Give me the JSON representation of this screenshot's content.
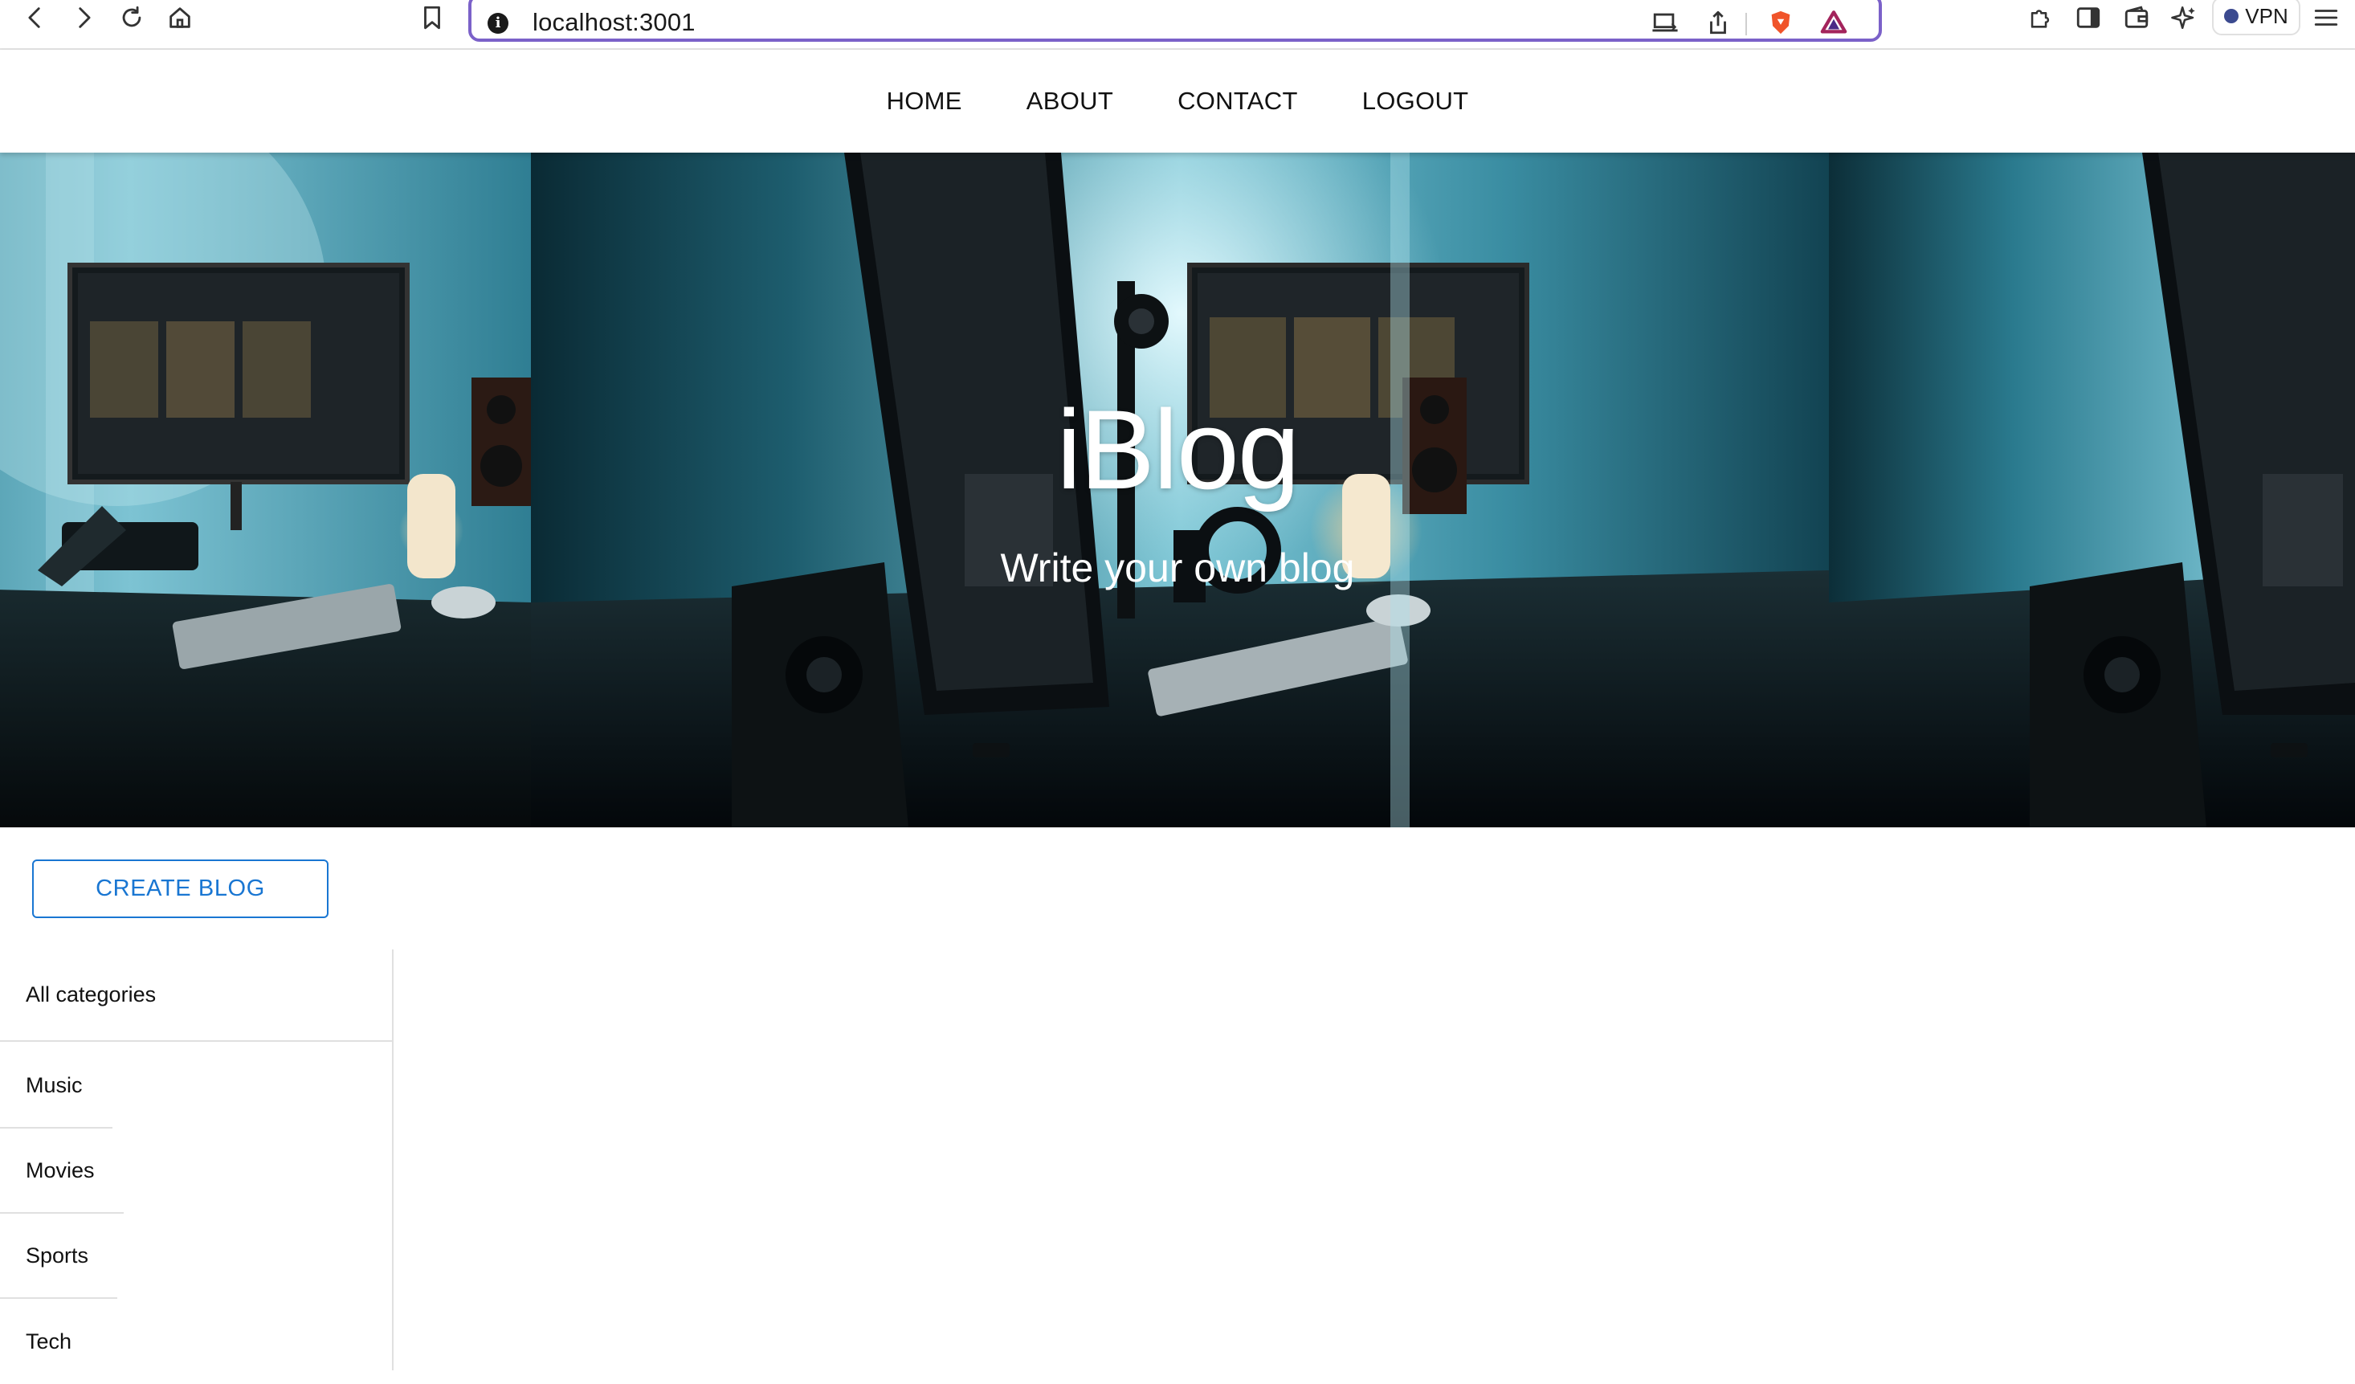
{
  "browser": {
    "url": "localhost:3001",
    "vpn_label": "VPN"
  },
  "nav": {
    "items": [
      "HOME",
      "ABOUT",
      "CONTACT",
      "LOGOUT"
    ]
  },
  "hero": {
    "title": "iBlog",
    "subtitle": "Write your own blog"
  },
  "actions": {
    "create_label": "CREATE BLOG"
  },
  "categories": {
    "all_label": "All categories",
    "items": [
      "Music",
      "Movies",
      "Sports",
      "Tech"
    ]
  },
  "colors": {
    "accent": "#1976d2",
    "url_border": "#7b61c9"
  }
}
